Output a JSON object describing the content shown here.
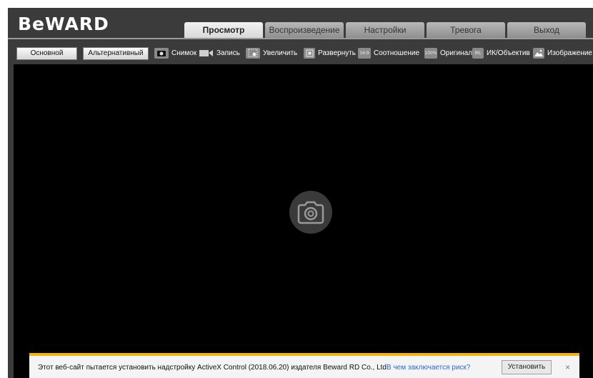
{
  "header": {
    "logo": "BeWARD"
  },
  "tabs": [
    {
      "label": "Просмотр",
      "active": true
    },
    {
      "label": "Воспроизведение"
    },
    {
      "label": "Настройки"
    },
    {
      "label": "Тревога"
    },
    {
      "label": "Выход"
    }
  ],
  "toolbar": {
    "stream_main": "Основной",
    "stream_alt": "Альтернативный",
    "tools": [
      {
        "label": "Снимок",
        "icon": "camera-icon"
      },
      {
        "label": "Запись",
        "icon": "video-record-icon"
      },
      {
        "label": "Увеличить",
        "icon": "zoom-icon"
      },
      {
        "label": "Развернуть",
        "icon": "fullscreen-icon"
      },
      {
        "label": "Соотношение",
        "icon": "aspect-ratio-icon",
        "glyph": "16:9"
      },
      {
        "label": "Оригинал",
        "icon": "original-size-icon",
        "glyph": "100%"
      },
      {
        "label": "ИК/Объектив",
        "icon": "ir-lens-icon",
        "glyph": "IRL"
      },
      {
        "label": "Изображение",
        "icon": "image-icon"
      }
    ]
  },
  "infobar": {
    "message": "Этот веб-сайт пытается установить надстройку ActiveX Control (2018.06.20) издателя Beward RD Co., Ltd.",
    "link": "В чем заключается риск?",
    "install_button": "Установить",
    "close": "×"
  },
  "colors": {
    "app_bg": "#3b3b3b",
    "video_bg": "#000000",
    "accent": "#f5b400",
    "link": "#2a6bd1"
  }
}
